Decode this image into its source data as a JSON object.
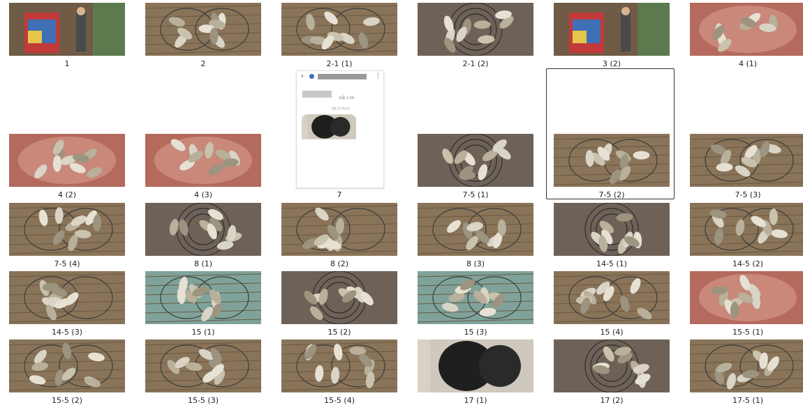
{
  "files": [
    {
      "label": "1",
      "scene": "sign"
    },
    {
      "label": "2",
      "scene": "net"
    },
    {
      "label": "2-1 (1)",
      "scene": "net"
    },
    {
      "label": "2-1 (2)",
      "scene": "ring"
    },
    {
      "label": "3 (2)",
      "scene": "sign"
    },
    {
      "label": "4 (1)",
      "scene": "red"
    },
    {
      "label": "4 (2)",
      "scene": "red"
    },
    {
      "label": "4 (3)",
      "scene": "red"
    },
    {
      "label": "7",
      "scene": "phone"
    },
    {
      "label": "7-5 (1)",
      "scene": "ring"
    },
    {
      "label": "7-5 (2)",
      "scene": "net"
    },
    {
      "label": "7-5 (3)",
      "scene": "net"
    },
    {
      "label": "7-5 (4)",
      "scene": "net"
    },
    {
      "label": "8 (1)",
      "scene": "ring"
    },
    {
      "label": "8 (2)",
      "scene": "net"
    },
    {
      "label": "8 (3)",
      "scene": "net"
    },
    {
      "label": "14-5 (1)",
      "scene": "ring"
    },
    {
      "label": "14-5 (2)",
      "scene": "net"
    },
    {
      "label": "14-5 (3)",
      "scene": "net"
    },
    {
      "label": "15 (1)",
      "scene": "water"
    },
    {
      "label": "15 (2)",
      "scene": "ring"
    },
    {
      "label": "15 (3)",
      "scene": "water"
    },
    {
      "label": "15 (4)",
      "scene": "net"
    },
    {
      "label": "15-5 (1)",
      "scene": "red"
    },
    {
      "label": "15-5 (2)",
      "scene": "net"
    },
    {
      "label": "15-5 (3)",
      "scene": "net"
    },
    {
      "label": "15-5 (4)",
      "scene": "net"
    },
    {
      "label": "17 (1)",
      "scene": "bag"
    },
    {
      "label": "17 (2)",
      "scene": "ring"
    },
    {
      "label": "17-5 (1)",
      "scene": "net"
    }
  ],
  "selected_label": "7-5 (2)",
  "phone_preview": {
    "back_glyph": "‹",
    "more_glyph": "⋮",
    "line1": "요즘 1:04",
    "line2": "8월 1일 화요일"
  }
}
